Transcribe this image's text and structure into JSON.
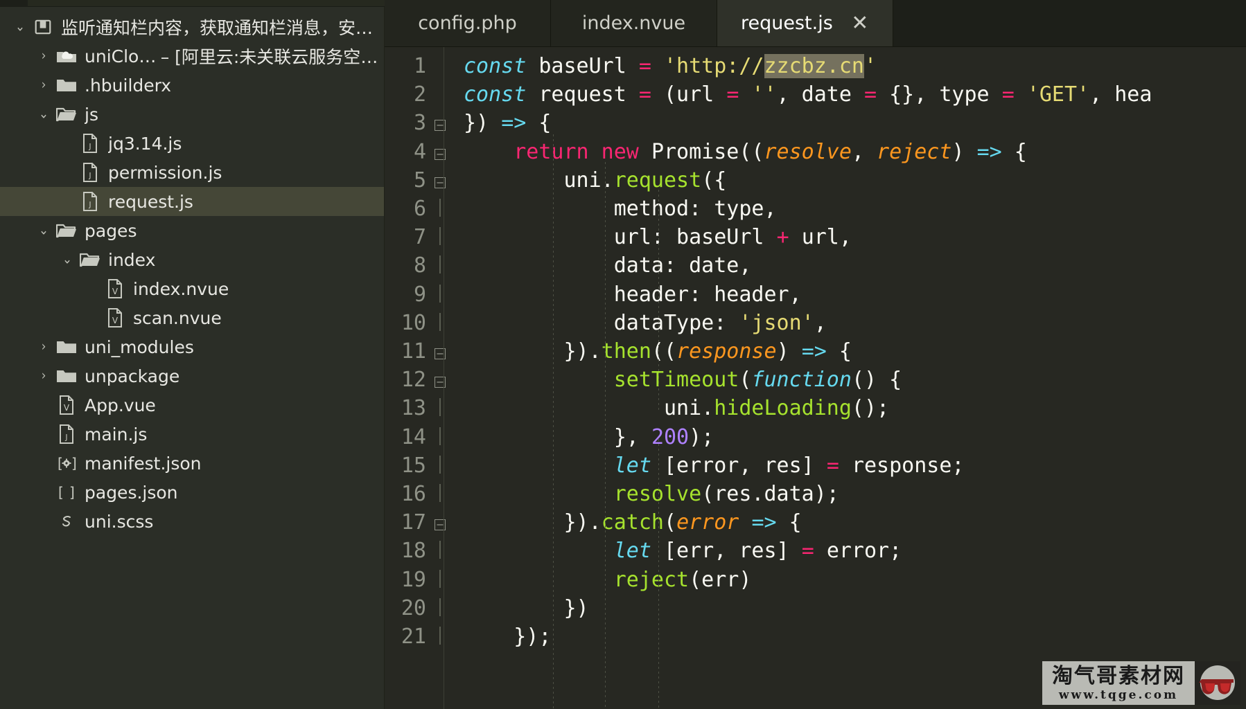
{
  "window": {
    "app": "HBuilderX editor window"
  },
  "sidebar": {
    "project": {
      "label": "监听通知栏内容，获取通知栏消息，安卓原…",
      "icon": "project-icon",
      "expanded": true
    },
    "items": [
      {
        "label": "uniCloud",
        "suffix": " – [阿里云:未关联云服务空间]",
        "icon": "cloud-folder-icon",
        "level": 1,
        "state": "collapsed",
        "selected": false
      },
      {
        "label": ".hbuilderx",
        "suffix": "",
        "icon": "folder-icon",
        "level": 1,
        "state": "collapsed",
        "selected": false
      },
      {
        "label": "js",
        "suffix": "",
        "icon": "folder-open-icon",
        "level": 1,
        "state": "expanded",
        "selected": false
      },
      {
        "label": "jq3.14.js",
        "suffix": "",
        "icon": "js-file-icon",
        "level": 2,
        "state": "leaf",
        "selected": false
      },
      {
        "label": "permission.js",
        "suffix": "",
        "icon": "js-file-icon",
        "level": 2,
        "state": "leaf",
        "selected": false
      },
      {
        "label": "request.js",
        "suffix": "",
        "icon": "js-file-icon",
        "level": 2,
        "state": "leaf",
        "selected": true
      },
      {
        "label": "pages",
        "suffix": "",
        "icon": "folder-open-icon",
        "level": 1,
        "state": "expanded",
        "selected": false
      },
      {
        "label": "index",
        "suffix": "",
        "icon": "folder-open-icon",
        "level": 2,
        "state": "expanded",
        "selected": false
      },
      {
        "label": "index.nvue",
        "suffix": "",
        "icon": "vue-file-icon",
        "level": 3,
        "state": "leaf",
        "selected": false
      },
      {
        "label": "scan.nvue",
        "suffix": "",
        "icon": "vue-file-icon",
        "level": 3,
        "state": "leaf",
        "selected": false
      },
      {
        "label": "uni_modules",
        "suffix": "",
        "icon": "folder-icon",
        "level": 1,
        "state": "collapsed",
        "selected": false
      },
      {
        "label": "unpackage",
        "suffix": "",
        "icon": "folder-icon",
        "level": 1,
        "state": "collapsed",
        "selected": false
      },
      {
        "label": "App.vue",
        "suffix": "",
        "icon": "vue-file-icon",
        "level": 1,
        "state": "leaf",
        "selected": false
      },
      {
        "label": "main.js",
        "suffix": "",
        "icon": "js-file-icon",
        "level": 1,
        "state": "leaf",
        "selected": false
      },
      {
        "label": "manifest.json",
        "suffix": "",
        "icon": "manifest-json-icon",
        "level": 1,
        "state": "leaf",
        "selected": false
      },
      {
        "label": "pages.json",
        "suffix": "",
        "icon": "pages-json-icon",
        "level": 1,
        "state": "leaf",
        "selected": false
      },
      {
        "label": "uni.scss",
        "suffix": "",
        "icon": "scss-file-icon",
        "level": 1,
        "state": "leaf",
        "selected": false
      }
    ]
  },
  "tabs": [
    {
      "label": "config.php",
      "active": false,
      "close_glyph": "✕"
    },
    {
      "label": "index.nvue",
      "active": false,
      "close_glyph": "✕"
    },
    {
      "label": "request.js",
      "active": true,
      "close_glyph": "✕"
    }
  ],
  "editor": {
    "language": "javascript",
    "selection_text": "zzcbz.cn",
    "lines": [
      {
        "n": "1",
        "fold": "none"
      },
      {
        "n": "2",
        "fold": "none"
      },
      {
        "n": "3",
        "fold": "box"
      },
      {
        "n": "4",
        "fold": "box"
      },
      {
        "n": "5",
        "fold": "box"
      },
      {
        "n": "6",
        "fold": "bar"
      },
      {
        "n": "7",
        "fold": "bar"
      },
      {
        "n": "8",
        "fold": "bar"
      },
      {
        "n": "9",
        "fold": "bar"
      },
      {
        "n": "10",
        "fold": "bar"
      },
      {
        "n": "11",
        "fold": "box"
      },
      {
        "n": "12",
        "fold": "box"
      },
      {
        "n": "13",
        "fold": "bar"
      },
      {
        "n": "14",
        "fold": "bar"
      },
      {
        "n": "15",
        "fold": "bar"
      },
      {
        "n": "16",
        "fold": "bar"
      },
      {
        "n": "17",
        "fold": "box"
      },
      {
        "n": "18",
        "fold": "bar"
      },
      {
        "n": "19",
        "fold": "bar"
      },
      {
        "n": "20",
        "fold": "bar"
      },
      {
        "n": "21",
        "fold": "bar"
      }
    ],
    "code_text": [
      "const baseUrl = 'http://zzcbz.cn'",
      "const request = (url = '', date = {}, type = 'GET', hea",
      "}) => {",
      "    return new Promise((resolve, reject) => {",
      "        uni.request({",
      "            method: type,",
      "            url: baseUrl + url,",
      "            data: date,",
      "            header: header,",
      "            dataType: 'json',",
      "        }).then((response) => {",
      "            setTimeout(function() {",
      "                uni.hideLoading();",
      "            }, 200);",
      "            let [error, res] = response;",
      "            resolve(res.data);",
      "        }).catch(error => {",
      "            let [err, res] = error;",
      "            reject(err)",
      "        })",
      "    });"
    ]
  },
  "watermark": {
    "cn_text": "淘气哥素材网",
    "url_text": "www.tqge.com",
    "logo": "glasses-logo-icon"
  },
  "colors": {
    "editor_bg": "#272822",
    "sidebar_bg": "#2b2e27",
    "selection_row": "#454737",
    "tab_active_bg": "#2f3129",
    "keyword": "#66d9ef",
    "operator": "#f92672",
    "string": "#e6db74",
    "function": "#a6e22e",
    "parameter": "#fd971f",
    "number": "#ae81ff",
    "selection_hl": "#75715e"
  }
}
